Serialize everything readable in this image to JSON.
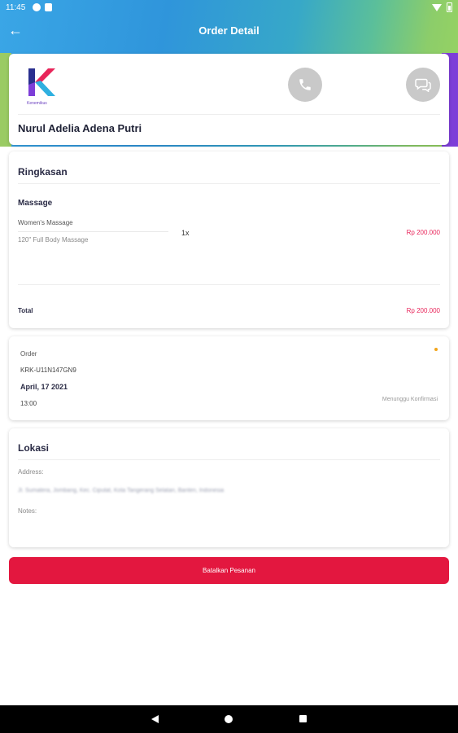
{
  "status_bar": {
    "time": "11:45"
  },
  "app_bar": {
    "title": "Order Detail"
  },
  "profile": {
    "logo_letter": "K",
    "logo_caption": "Kenemikus",
    "customer_name": "Nurul Adelia Adena Putri"
  },
  "summary": {
    "title": "Ringkasan",
    "category": "Massage",
    "item": {
      "name": "Women's Massage",
      "description": "120\" Full Body Massage",
      "quantity": "1x",
      "price": "Rp 200.000"
    },
    "total_label": "Total",
    "total_value": "Rp 200.000"
  },
  "order": {
    "label": "Order",
    "id": "KRK-U11N147GN9",
    "date": "April, 17 2021",
    "time": "13:00",
    "status": "Menunggu Konfirmasi",
    "status_color": "#f2a51a"
  },
  "location": {
    "title": "Lokasi",
    "address_label": "Address:",
    "address_value": "Jl. Sumatera, Jombang, Kec. Ciputat, Kota Tangerang Selatan, Banten, Indonesia",
    "notes_label": "Notes:"
  },
  "actions": {
    "cancel_label": "Batalkan Pesanan",
    "cancel_color": "#e3173f"
  },
  "colors": {
    "price": "#e8255a",
    "header_start": "#3aa6e6",
    "header_end": "#9ad45f",
    "accent_purple": "#7d3ed8"
  }
}
